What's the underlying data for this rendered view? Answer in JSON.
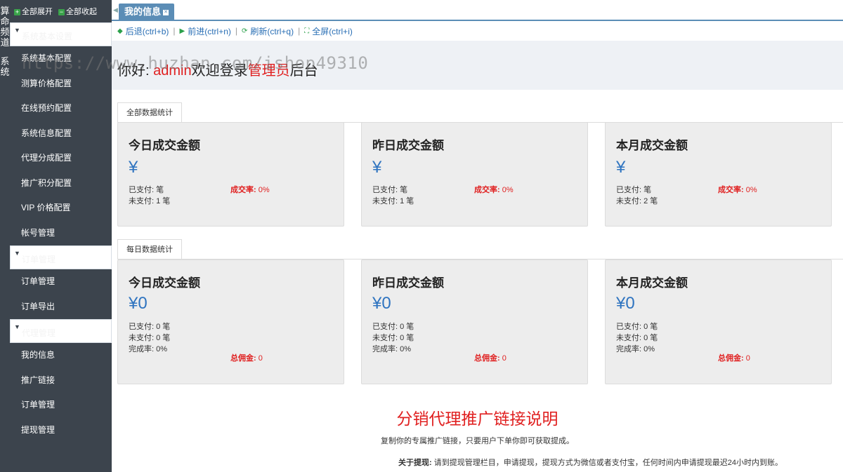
{
  "vstrip": {
    "segments": [
      "算命频道",
      "系统"
    ]
  },
  "sidebar": {
    "expand_all": "全部展开",
    "collapse_all": "全部收起",
    "groups": [
      {
        "title": "系统基本设置",
        "items": [
          "系统基本配置",
          "测算价格配置",
          "在线预约配置",
          "系统信息配置",
          "代理分成配置",
          "推广积分配置",
          "VIP 价格配置",
          "帐号管理"
        ]
      },
      {
        "title": "订单管理",
        "items": [
          "订单管理",
          "订单导出"
        ]
      },
      {
        "title": "代理管理",
        "items": [
          "我的信息",
          "推广链接",
          "订单管理",
          "提现管理"
        ]
      }
    ]
  },
  "tabs": {
    "active": "我的信息"
  },
  "toolbar": {
    "back": "后退(ctrl+b)",
    "forward": "前进(ctrl+n)",
    "refresh": "刷新(ctrl+q)",
    "fullscreen": "全屏(ctrl+i)"
  },
  "welcome": {
    "prefix": "你好:",
    "user": "admin",
    "middle": "欢迎登录",
    "role": "管理员",
    "suffix": "后台"
  },
  "watermark": "https://www.huzhan.com/ishop49310",
  "section_all": {
    "label": "全部数据统计",
    "cards": [
      {
        "title": "今日成交金额",
        "amount": "¥",
        "paid": "已支付: 笔",
        "unpaid": "未支付: 1 笔",
        "rate_label": "成交率:",
        "rate_value": "0%"
      },
      {
        "title": "昨日成交金额",
        "amount": "¥",
        "paid": "已支付: 笔",
        "unpaid": "未支付: 1 笔",
        "rate_label": "成交率:",
        "rate_value": "0%"
      },
      {
        "title": "本月成交金额",
        "amount": "¥",
        "paid": "已支付: 笔",
        "unpaid": "未支付: 2 笔",
        "rate_label": "成交率:",
        "rate_value": "0%"
      }
    ]
  },
  "section_daily": {
    "label": "每日数据统计",
    "cards": [
      {
        "title": "今日成交金额",
        "amount": "¥0",
        "paid": "已支付: 0 笔",
        "unpaid": "未支付: 0 笔",
        "done": "完成率: 0%",
        "comm_label": "总佣金:",
        "comm_value": "0"
      },
      {
        "title": "昨日成交金额",
        "amount": "¥0",
        "paid": "已支付: 0 笔",
        "unpaid": "未支付: 0 笔",
        "done": "完成率: 0%",
        "comm_label": "总佣金:",
        "comm_value": "0"
      },
      {
        "title": "本月成交金额",
        "amount": "¥0",
        "paid": "已支付: 0 笔",
        "unpaid": "未支付: 0 笔",
        "done": "完成率: 0%",
        "comm_label": "总佣金:",
        "comm_value": "0"
      }
    ]
  },
  "promo": {
    "title": "分销代理推广链接说明",
    "subtitle": "复制你的专属推广链接，只要用户下单你即可获取提成。",
    "note_label": "关于提现:",
    "note_text": "请到提现管理栏目，申请提现，提现方式为微信或者支付宝，任何时间内申请提现最迟24小时内到账。"
  },
  "colors": {
    "sidebar_bg": "#3c444d",
    "accent_blue": "#5b8db6",
    "amount_blue": "#2f74c0",
    "red": "#e02020"
  }
}
